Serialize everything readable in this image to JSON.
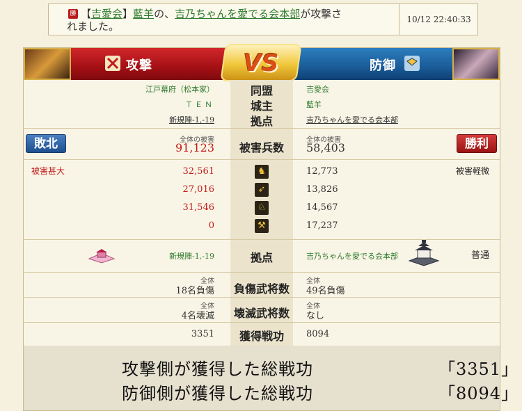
{
  "notice": {
    "badge": "勝",
    "bracket_open": "【",
    "alliance": "吉愛会",
    "bracket_close": "】",
    "player": "藍羊",
    "mid_text": "の、",
    "target": "吉乃ちゃんを愛でる会本部",
    "end_text": "が攻撃さ",
    "wrap_text": "れました。",
    "timestamp": "10/12 22:40:33"
  },
  "banner": {
    "attack_title": "攻撃",
    "defense_title": "防御",
    "vs": "VS"
  },
  "info": {
    "alliance_label": "同盟",
    "lord_label": "城主",
    "base_label": "拠点",
    "attacker_alliance": "江戸幕府（松本家）",
    "attacker_lord": "ＴＥＮ",
    "attacker_base": "新規陣-1,-19",
    "defender_alliance": "吉愛会",
    "defender_lord": "藍羊",
    "defender_base": "吉乃ちゃんを愛でる会本部"
  },
  "casualties": {
    "label": "被害兵数",
    "total_caption": "全体の被害",
    "attacker_result": "敗北",
    "defender_result": "勝利",
    "attacker_total": "91,123",
    "defender_total": "58,403",
    "attacker_severity": "被害甚大",
    "defender_severity": "被害軽微",
    "units": [
      {
        "icon": "spearman-icon",
        "attacker": "32,561",
        "defender": "12,773"
      },
      {
        "icon": "archer-icon",
        "attacker": "27,016",
        "defender": "13,826"
      },
      {
        "icon": "cavalry-icon",
        "attacker": "31,546",
        "defender": "14,567"
      },
      {
        "icon": "siege-icon",
        "attacker": "0",
        "defender": "17,237"
      }
    ]
  },
  "base_row": {
    "label": "拠点",
    "attacker_base": "新規陣-1,-19",
    "defender_base": "吉乃ちゃんを愛でる会本部",
    "defender_status": "普通"
  },
  "injured": {
    "label": "負傷武将数",
    "caption": "全体",
    "attacker": "18名負傷",
    "defender": "49名負傷"
  },
  "destroyed": {
    "label": "壊滅武将数",
    "caption": "全体",
    "attacker": "4名壊滅",
    "defender": "なし"
  },
  "merit": {
    "label": "獲得戦功",
    "attacker": "3351",
    "defender": "8094"
  },
  "totals": {
    "attack_line": "攻撃側が獲得した総戦功",
    "attack_value": "「3351」",
    "defense_line": "防御側が獲得した総戦功",
    "defense_value": "「8094」"
  },
  "colors": {
    "attack_red": "#a41015",
    "defense_blue": "#1a5c98",
    "link_green": "#2d7a2d",
    "damage_red": "#c21a1a"
  }
}
